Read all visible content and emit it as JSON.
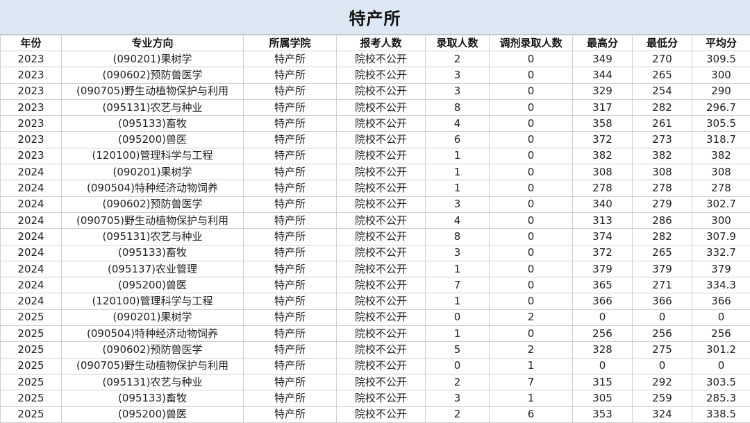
{
  "title": "特产所",
  "headers": [
    "年份",
    "专业方向",
    "所属学院",
    "报考人数",
    "录取人数",
    "调剂录取人数",
    "最高分",
    "最低分",
    "平均分"
  ],
  "rows": [
    [
      "2023",
      "(090201)果树学",
      "特产所",
      "院校不公开",
      "2",
      "0",
      "349",
      "270",
      "309.5"
    ],
    [
      "2023",
      "(090602)预防兽医学",
      "特产所",
      "院校不公开",
      "3",
      "0",
      "344",
      "265",
      "300"
    ],
    [
      "2023",
      "(090705)野生动植物保护与利用",
      "特产所",
      "院校不公开",
      "3",
      "0",
      "329",
      "254",
      "290"
    ],
    [
      "2023",
      "(095131)农艺与种业",
      "特产所",
      "院校不公开",
      "8",
      "0",
      "317",
      "282",
      "296.7"
    ],
    [
      "2023",
      "(095133)畜牧",
      "特产所",
      "院校不公开",
      "4",
      "0",
      "358",
      "261",
      "305.5"
    ],
    [
      "2023",
      "(095200)兽医",
      "特产所",
      "院校不公开",
      "6",
      "0",
      "372",
      "273",
      "318.7"
    ],
    [
      "2023",
      "(120100)管理科学与工程",
      "特产所",
      "院校不公开",
      "1",
      "0",
      "382",
      "382",
      "382"
    ],
    [
      "2024",
      "(090201)果树学",
      "特产所",
      "院校不公开",
      "1",
      "0",
      "308",
      "308",
      "308"
    ],
    [
      "2024",
      "(090504)特种经济动物饲养",
      "特产所",
      "院校不公开",
      "1",
      "0",
      "278",
      "278",
      "278"
    ],
    [
      "2024",
      "(090602)预防兽医学",
      "特产所",
      "院校不公开",
      "3",
      "0",
      "340",
      "279",
      "302.7"
    ],
    [
      "2024",
      "(090705)野生动植物保护与利用",
      "特产所",
      "院校不公开",
      "4",
      "0",
      "313",
      "286",
      "300"
    ],
    [
      "2024",
      "(095131)农艺与种业",
      "特产所",
      "院校不公开",
      "8",
      "0",
      "374",
      "282",
      "307.9"
    ],
    [
      "2024",
      "(095133)畜牧",
      "特产所",
      "院校不公开",
      "3",
      "0",
      "372",
      "265",
      "332.7"
    ],
    [
      "2024",
      "(095137)农业管理",
      "特产所",
      "院校不公开",
      "1",
      "0",
      "379",
      "379",
      "379"
    ],
    [
      "2024",
      "(095200)兽医",
      "特产所",
      "院校不公开",
      "7",
      "0",
      "365",
      "271",
      "334.3"
    ],
    [
      "2024",
      "(120100)管理科学与工程",
      "特产所",
      "院校不公开",
      "1",
      "0",
      "366",
      "366",
      "366"
    ],
    [
      "2025",
      "(090201)果树学",
      "特产所",
      "院校不公开",
      "0",
      "2",
      "0",
      "0",
      "0"
    ],
    [
      "2025",
      "(090504)特种经济动物饲养",
      "特产所",
      "院校不公开",
      "1",
      "0",
      "256",
      "256",
      "256"
    ],
    [
      "2025",
      "(090602)预防兽医学",
      "特产所",
      "院校不公开",
      "5",
      "2",
      "328",
      "275",
      "301.2"
    ],
    [
      "2025",
      "(090705)野生动植物保护与利用",
      "特产所",
      "院校不公开",
      "0",
      "1",
      "0",
      "0",
      "0"
    ],
    [
      "2025",
      "(095131)农艺与种业",
      "特产所",
      "院校不公开",
      "2",
      "7",
      "315",
      "292",
      "303.5"
    ],
    [
      "2025",
      "(095133)畜牧",
      "特产所",
      "院校不公开",
      "3",
      "1",
      "305",
      "259",
      "285.3"
    ],
    [
      "2025",
      "(095200)兽医",
      "特产所",
      "院校不公开",
      "2",
      "6",
      "353",
      "324",
      "338.5"
    ]
  ]
}
